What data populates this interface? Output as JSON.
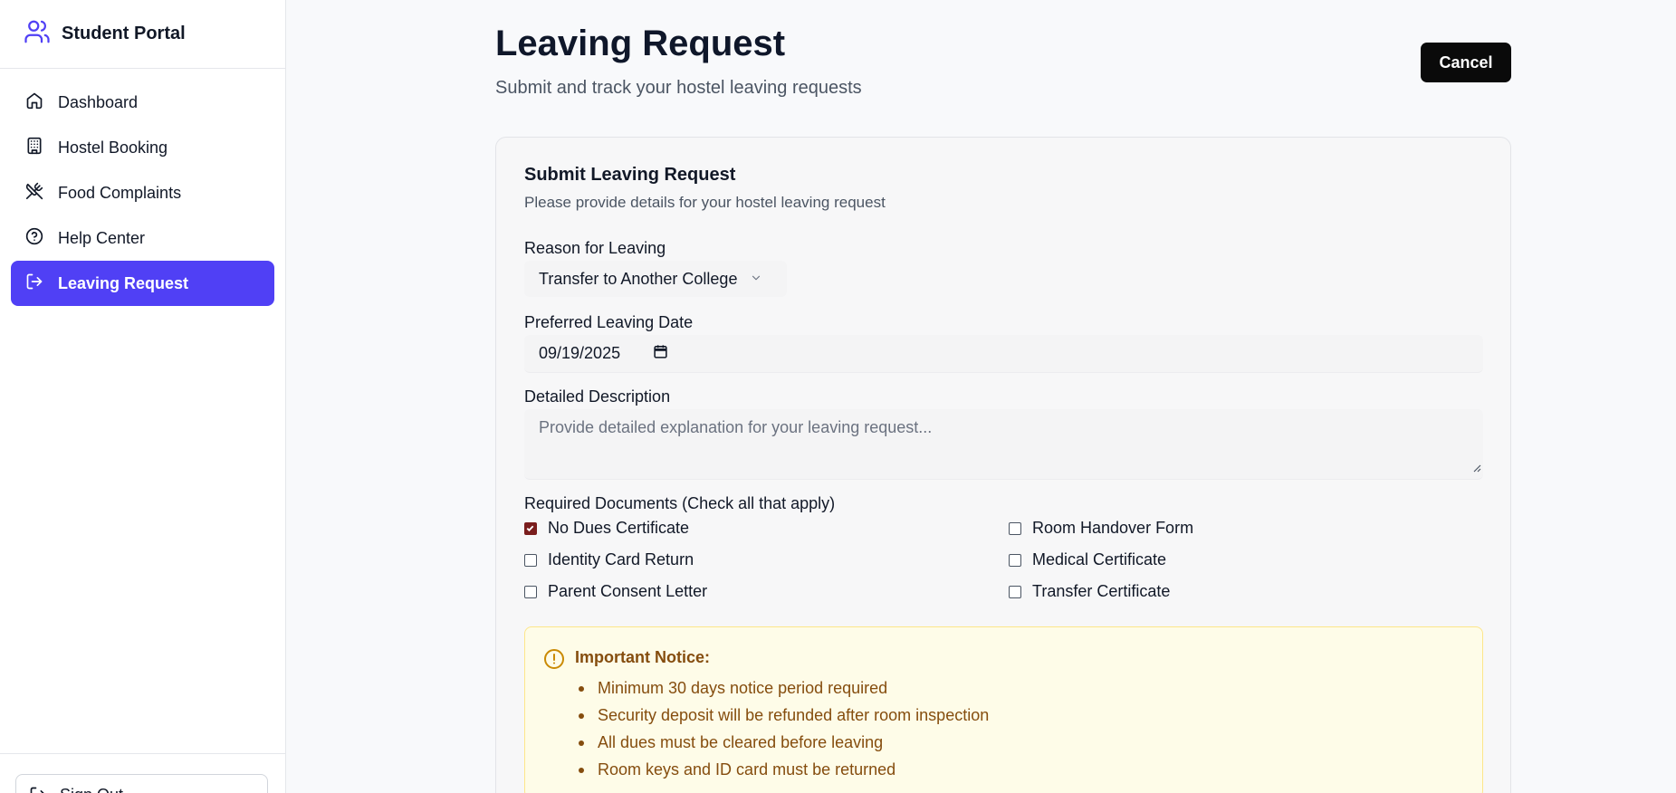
{
  "sidebar": {
    "brand": "Student Portal",
    "items": [
      {
        "label": "Dashboard",
        "icon": "home-icon"
      },
      {
        "label": "Hostel Booking",
        "icon": "building-icon"
      },
      {
        "label": "Food Complaints",
        "icon": "utensils-crossed-icon"
      },
      {
        "label": "Help Center",
        "icon": "help-circle-icon"
      },
      {
        "label": "Leaving Request",
        "icon": "log-out-icon",
        "active": true
      }
    ],
    "signout_label": "Sign Out"
  },
  "header": {
    "title": "Leaving Request",
    "subtitle": "Submit and track your hostel leaving requests",
    "cancel_label": "Cancel"
  },
  "form": {
    "title": "Submit Leaving Request",
    "description": "Please provide details for your hostel leaving request",
    "reason_label": "Reason for Leaving",
    "reason_value": "Transfer to Another College",
    "date_label": "Preferred Leaving Date",
    "date_value": "09/19/2025",
    "description_label": "Detailed Description",
    "description_placeholder": "Provide detailed explanation for your leaving request...",
    "documents_label": "Required Documents (Check all that apply)",
    "documents": [
      {
        "label": "No Dues Certificate",
        "checked": true
      },
      {
        "label": "Room Handover Form",
        "checked": false
      },
      {
        "label": "Identity Card Return",
        "checked": false
      },
      {
        "label": "Medical Certificate",
        "checked": false
      },
      {
        "label": "Parent Consent Letter",
        "checked": false
      },
      {
        "label": "Transfer Certificate",
        "checked": false
      }
    ]
  },
  "notice": {
    "title": "Important Notice:",
    "items": [
      "Minimum 30 days notice period required",
      "Security deposit will be refunded after room inspection",
      "All dues must be cleared before leaving",
      "Room keys and ID card must be returned"
    ]
  },
  "colors": {
    "accent": "#5040f5",
    "checkbox_checked": "#7a1d1d",
    "notice_bg": "#fefce8",
    "notice_text": "#854d0e"
  }
}
